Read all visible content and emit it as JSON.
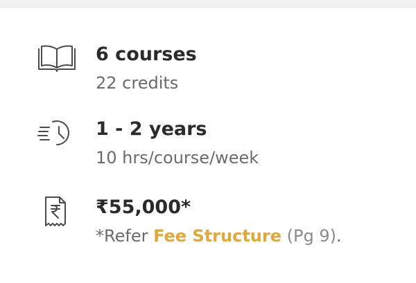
{
  "items": [
    {
      "icon": "book-icon",
      "title": "6 courses",
      "subtitle": "22 credits"
    },
    {
      "icon": "clock-icon",
      "title": "1 - 2 years",
      "subtitle": "10 hrs/course/week"
    },
    {
      "icon": "receipt-rupee-icon",
      "title": "₹55,000*",
      "subtitle_prefix": "*Refer ",
      "subtitle_link": "Fee Structure",
      "subtitle_pg": " (Pg 9)",
      "subtitle_suffix": "."
    }
  ],
  "colors": {
    "title": "#2b2b2b",
    "subtitle": "#6b6b6b",
    "link": "#e1a93c",
    "icon": "#4a4a4a"
  }
}
